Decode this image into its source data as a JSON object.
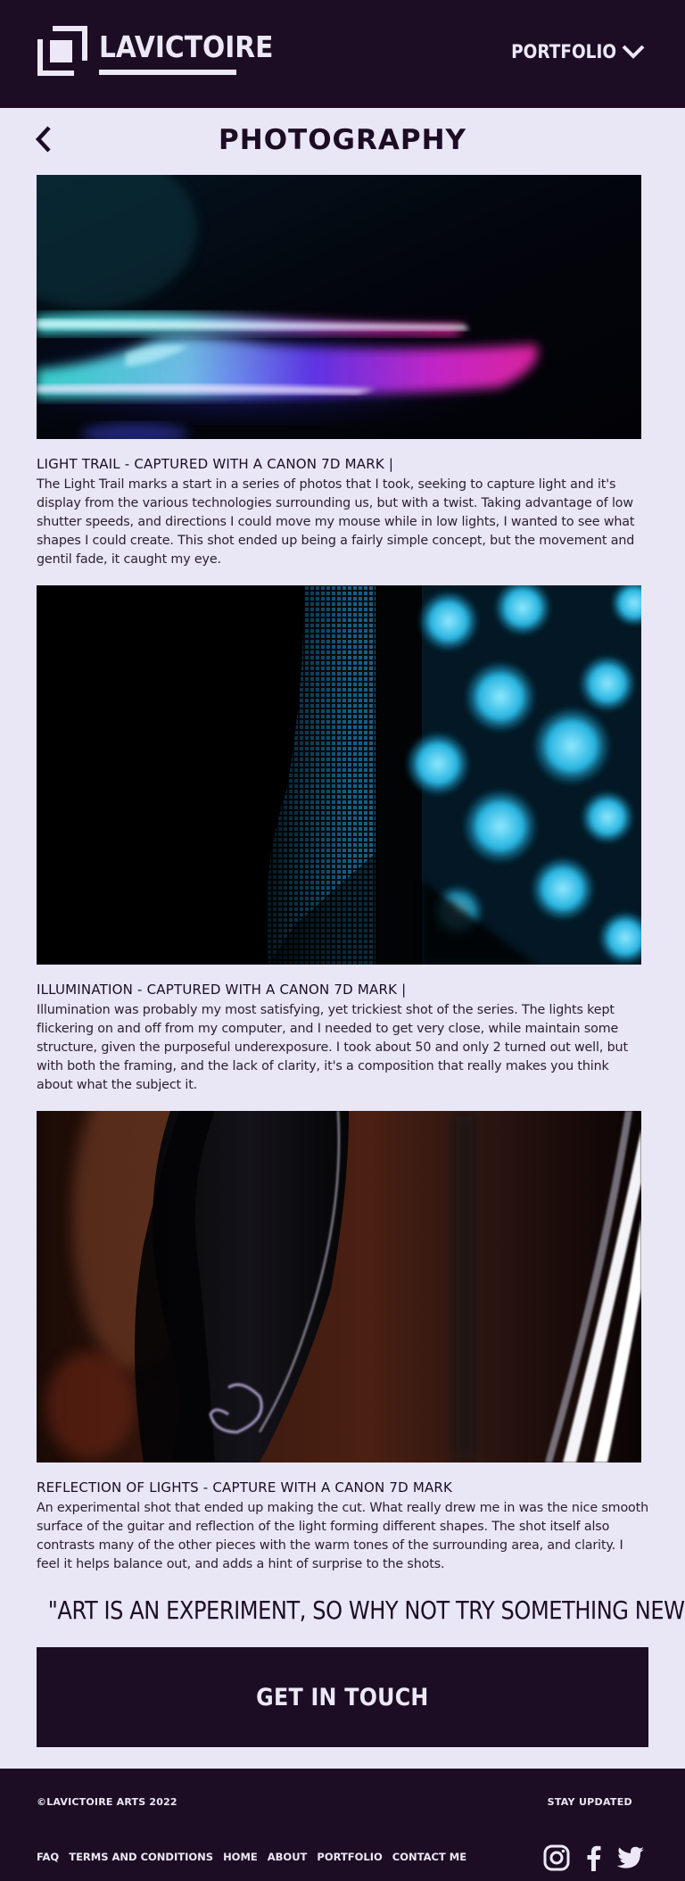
{
  "header": {
    "logo_text": "LAVICTOIRE",
    "nav_label": "PORTFOLIO"
  },
  "page": {
    "title": "PHOTOGRAPHY"
  },
  "entries": [
    {
      "title": "LIGHT TRAIL - CAPTURED WITH A CANON 7D MARK |",
      "body": "The Light Trail marks a start in a series of photos that I took, seeking to capture light and it's display from the various technologies surrounding us, but with a twist. Taking advantage of low shutter speeds, and directions I could move my mouse while in low lights, I wanted to see what shapes I could create. This shot ended up being a fairly simple concept, but the movement and gentil fade, it caught my eye."
    },
    {
      "title": "ILLUMINATION - CAPTURED WITH A CANON 7D MARK |",
      "body": "Illumination was probably my most satisfying, yet trickiest shot of the series. The lights kept flickering on and off from my computer, and I needed to get very close, while maintain some structure, given the purposeful underexposure. I took about 50 and only 2 turned out well, but with both the framing, and the lack of clarity, it's a composition that really makes you think about what the subject it."
    },
    {
      "title": "REFLECTION OF LIGHTS - CAPTURE WITH A CANON 7D MARK",
      "body": "An experimental shot that ended up making the cut. What really drew me in was the nice smooth surface of the guitar and reflection of the light forming different shapes. The shot itself also contrasts many of the other pieces with the warm tones of the surrounding area, and clarity. I feel it helps balance out, and adds a hint of surprise to the shots."
    }
  ],
  "quote": "\"ART IS AN EXPERIMENT, SO WHY NOT TRY SOMETHING NEW?\"",
  "cta": {
    "label": "GET IN TOUCH"
  },
  "footer": {
    "copyright": "©LAVICTOIRE ARTS 2022",
    "stay_updated": "STAY UPDATED",
    "links": [
      "FAQ",
      "TERMS AND CONDITIONS",
      "HOME",
      "ABOUT",
      "PORTFOLIO",
      "CONTACT ME"
    ],
    "social_icons": [
      "instagram-icon",
      "facebook-icon",
      "twitter-icon"
    ]
  },
  "colors": {
    "dark": "#1C0D24",
    "background": "#E9E6F6",
    "light_text": "#ECE8F7"
  }
}
